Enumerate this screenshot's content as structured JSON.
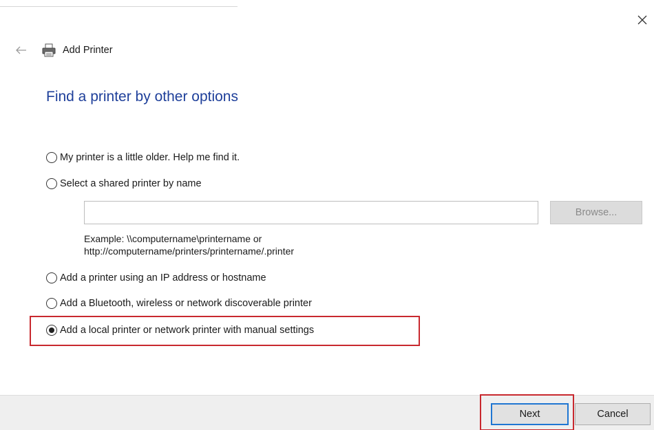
{
  "window": {
    "title": "Add Printer",
    "close_icon": "close-icon",
    "back_icon": "back-arrow-icon",
    "printer_icon": "printer-icon"
  },
  "heading": "Find a printer by other options",
  "options": [
    {
      "label": "My printer is a little older. Help me find it.",
      "checked": false
    },
    {
      "label": "Select a shared printer by name",
      "checked": false
    },
    {
      "label": "Add a printer using an IP address or hostname",
      "checked": false
    },
    {
      "label": "Add a Bluetooth, wireless or network discoverable printer",
      "checked": false
    },
    {
      "label": "Add a local printer or network printer with manual settings",
      "checked": true
    }
  ],
  "shared_printer": {
    "value": "",
    "browse_label": "Browse...",
    "example_line1": "Example: \\\\computername\\printername or",
    "example_line2": "http://computername/printers/printername/.printer"
  },
  "footer": {
    "next_label": "Next",
    "cancel_label": "Cancel"
  },
  "colors": {
    "heading": "#1e3f9a",
    "highlight": "#c8282e",
    "default_button_border": "#1f76d2",
    "footer_bg": "#efefef"
  }
}
